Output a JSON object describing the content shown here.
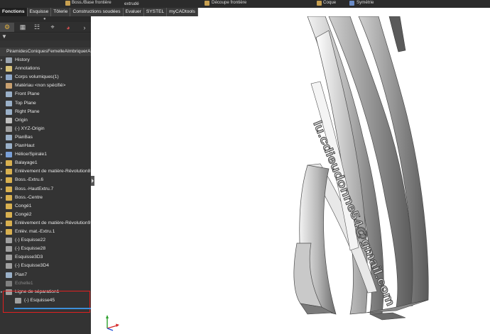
{
  "ribbon": {
    "items": [
      {
        "label": "Boss./Base frontière"
      },
      {
        "label": "extrudé"
      },
      {
        "label": "Découpe frontière"
      },
      {
        "label": "Coque"
      },
      {
        "label": "Symétrie"
      }
    ]
  },
  "command_tabs": [
    {
      "label": "Fonctions",
      "active": true
    },
    {
      "label": "Esquisse"
    },
    {
      "label": "Tôlerie"
    },
    {
      "label": "Constructions soudées"
    },
    {
      "label": "Evaluer"
    },
    {
      "label": "SYSTEL"
    },
    {
      "label": "myCADtools"
    }
  ],
  "heads_up_icons": [
    "zoom-to-fit-icon",
    "zoom-area-icon",
    "previous-view-icon",
    "section-view-icon",
    "view-orientation-icon",
    "display-style-icon",
    "hide-show-icon",
    "edit-appearance-icon",
    "apply-scene-icon",
    "view-settings-icon",
    "monitor-icon"
  ],
  "panel": {
    "tabs": [
      "feature-manager-icon",
      "property-manager-icon",
      "configuration-manager-icon",
      "dimxpert-icon",
      "display-manager-icon",
      "more-icon"
    ],
    "root_label": "PiramidesConiquesFemelleAlmbriquerA",
    "items": [
      {
        "label": "History",
        "icon": "history-icon",
        "color": "#9aa4b0"
      },
      {
        "label": "Annotations",
        "icon": "annotations-icon",
        "color": "#d8c27a"
      },
      {
        "label": "Corps volumiques(1)",
        "icon": "solid-bodies-icon",
        "color": "#8fa8c8"
      },
      {
        "label": "Matériau <non spécifié>",
        "icon": "material-icon",
        "color": "#c8a070"
      },
      {
        "label": "Front Plane",
        "icon": "plane-icon",
        "color": "#9ab0c8"
      },
      {
        "label": "Top Plane",
        "icon": "plane-icon",
        "color": "#9ab0c8"
      },
      {
        "label": "Right Plane",
        "icon": "plane-icon",
        "color": "#9ab0c8"
      },
      {
        "label": "Origin",
        "icon": "origin-icon",
        "color": "#c0c0c0"
      },
      {
        "label": "(-) XYZ-Origin",
        "icon": "sketch-icon",
        "color": "#a0a0a0"
      },
      {
        "label": "PlanBas",
        "icon": "plane-icon",
        "color": "#9ab0c8"
      },
      {
        "label": "PlanHaut",
        "icon": "plane-icon",
        "color": "#9ab0c8"
      },
      {
        "label": "Hélice/Spirale1",
        "icon": "helix-icon",
        "color": "#7aa0d8"
      },
      {
        "label": "Balayage1",
        "icon": "sweep-icon",
        "color": "#d8b050"
      },
      {
        "label": "Enlèvement de matière-Révolution8",
        "icon": "cut-revolve-icon",
        "color": "#d8b050"
      },
      {
        "label": "Boss.-Extru.6",
        "icon": "boss-extrude-icon",
        "color": "#d8b050"
      },
      {
        "label": "Boss.-HautExtru.7",
        "icon": "boss-extrude-icon",
        "color": "#d8b050"
      },
      {
        "label": "Boss.-Centre",
        "icon": "boss-extrude-icon",
        "color": "#d8b050"
      },
      {
        "label": "Congé1",
        "icon": "fillet-icon",
        "color": "#d8b050"
      },
      {
        "label": "Congé2",
        "icon": "fillet-icon",
        "color": "#d8b050"
      },
      {
        "label": "Enlèvement de matière-Révolution9",
        "icon": "cut-revolve-icon",
        "color": "#d8b050"
      },
      {
        "label": "Enlèv. mat.-Extru.1",
        "icon": "cut-extrude-icon",
        "color": "#d8b050"
      },
      {
        "label": "(-) Esquisse22",
        "icon": "sketch-icon",
        "color": "#a0a0a0"
      },
      {
        "label": "(-) Esquisse28",
        "icon": "sketch-icon",
        "color": "#a0a0a0"
      },
      {
        "label": "Esquisse3D3",
        "icon": "sketch3d-icon",
        "color": "#a0a0a0"
      },
      {
        "label": "(-) Esquisse3D4",
        "icon": "sketch3d-icon",
        "color": "#a0a0a0"
      },
      {
        "label": "Plan7",
        "icon": "plane-icon",
        "color": "#9ab0c8"
      },
      {
        "label": "Echelle1",
        "icon": "scale-icon",
        "color": "#808080",
        "dim": true
      },
      {
        "label": "Ligne de séparation1",
        "icon": "split-line-icon",
        "color": "#a0a0a0"
      },
      {
        "label": "(-) Esquisse45",
        "icon": "sketch-icon",
        "color": "#a0a0a0",
        "child": true
      }
    ]
  },
  "model": {
    "engraved_text": "lu.cdieudonne54@gmail.com"
  },
  "colors": {
    "panel_bg": "#333333",
    "ribbon_bg": "#2b2b2b",
    "selection_outline": "#e02020",
    "accent_blue": "#3d8fd9"
  }
}
